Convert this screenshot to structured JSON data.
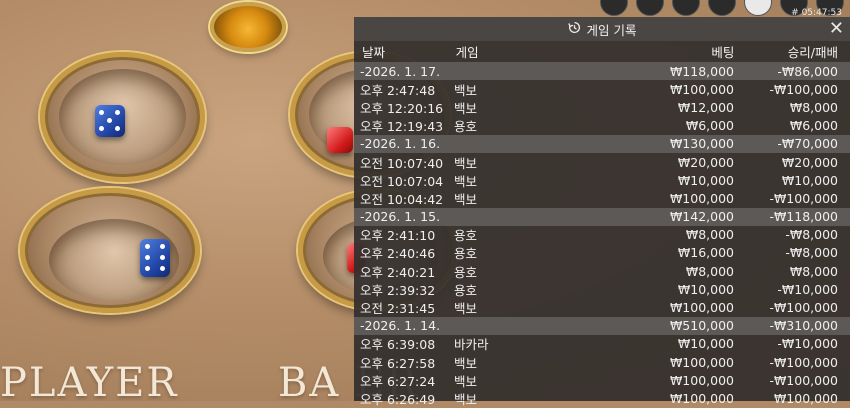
{
  "clock": "# 05:47:53",
  "table": {
    "player_label": "PLAYER",
    "banker_label": "BA    ER"
  },
  "panel": {
    "title": "게임 기록",
    "title_icon": "history-icon",
    "close_icon": "close-icon",
    "columns": {
      "date": "날짜",
      "game": "게임",
      "bet": "베팅",
      "win": "승리/패배"
    },
    "groups": [
      {
        "date": "-2026. 1. 17.",
        "bet": "₩118,000",
        "win": "-₩86,000",
        "rows": [
          {
            "time": "오후 2:47:48",
            "game": "백보",
            "bet": "₩100,000",
            "win": "-₩100,000"
          },
          {
            "time": "오후 12:20:16",
            "game": "백보",
            "bet": "₩12,000",
            "win": "₩8,000"
          },
          {
            "time": "오후 12:19:43",
            "game": "용호",
            "bet": "₩6,000",
            "win": "₩6,000"
          }
        ]
      },
      {
        "date": "-2026. 1. 16.",
        "bet": "₩130,000",
        "win": "-₩70,000",
        "rows": [
          {
            "time": "오전 10:07:40",
            "game": "백보",
            "bet": "₩20,000",
            "win": "₩20,000"
          },
          {
            "time": "오전 10:07:04",
            "game": "백보",
            "bet": "₩10,000",
            "win": "₩10,000"
          },
          {
            "time": "오전 10:04:42",
            "game": "백보",
            "bet": "₩100,000",
            "win": "-₩100,000"
          }
        ]
      },
      {
        "date": "-2026. 1. 15.",
        "bet": "₩142,000",
        "win": "-₩118,000",
        "rows": [
          {
            "time": "오후 2:41:10",
            "game": "용호",
            "bet": "₩8,000",
            "win": "-₩8,000"
          },
          {
            "time": "오후 2:40:46",
            "game": "용호",
            "bet": "₩16,000",
            "win": "-₩8,000"
          },
          {
            "time": "오후 2:40:21",
            "game": "용호",
            "bet": "₩8,000",
            "win": "₩8,000"
          },
          {
            "time": "오후 2:39:32",
            "game": "용호",
            "bet": "₩10,000",
            "win": "-₩10,000"
          },
          {
            "time": "오전 2:31:45",
            "game": "백보",
            "bet": "₩100,000",
            "win": "-₩100,000"
          }
        ]
      },
      {
        "date": "-2026. 1. 14.",
        "bet": "₩510,000",
        "win": "-₩310,000",
        "rows": [
          {
            "time": "오후 6:39:08",
            "game": "바카라",
            "bet": "₩10,000",
            "win": "-₩10,000"
          },
          {
            "time": "오후 6:27:58",
            "game": "백보",
            "bet": "₩100,000",
            "win": "-₩100,000"
          },
          {
            "time": "오후 6:27:24",
            "game": "백보",
            "bet": "₩100,000",
            "win": "-₩100,000"
          },
          {
            "time": "오후 6:26:49",
            "game": "백보",
            "bet": "₩100,000",
            "win": "₩100,000"
          }
        ]
      }
    ]
  }
}
